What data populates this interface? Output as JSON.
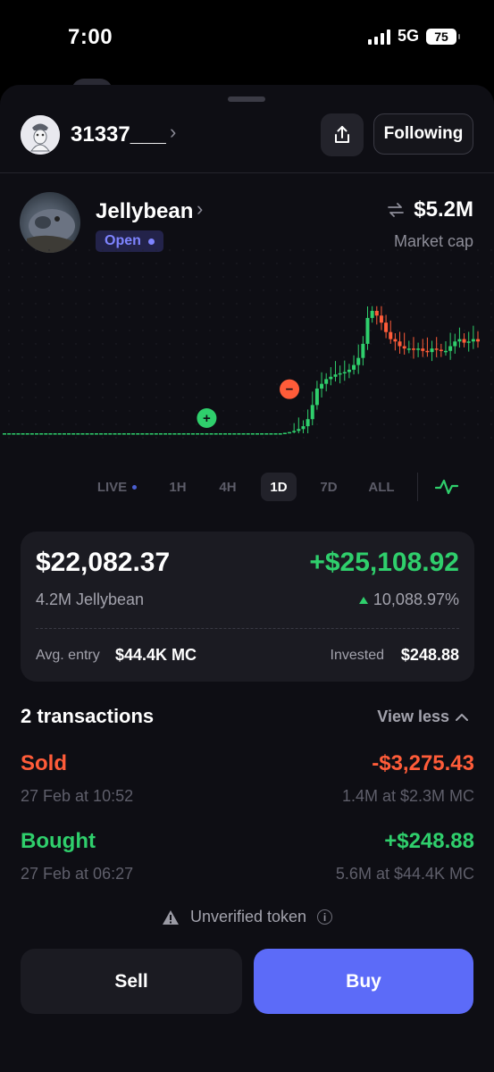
{
  "status_bar": {
    "time": "7:00",
    "network": "5G",
    "battery": "75"
  },
  "profile": {
    "username": "31337___",
    "follow_label": "Following"
  },
  "token": {
    "name": "Jellybean",
    "status": "Open",
    "market_cap": "$5.2M",
    "market_cap_label": "Market cap"
  },
  "chart_data": {
    "type": "candlestick",
    "title": "",
    "xlabel": "",
    "ylabel": "",
    "grid": true,
    "y_axis_visible": false,
    "candles_up_color": "#2fcf6c",
    "candles_down_color": "#ff5c39",
    "markers": [
      {
        "label": "+",
        "kind": "buy",
        "color": "#2fcf6c"
      },
      {
        "label": "−",
        "kind": "sell",
        "color": "#ff5c39"
      }
    ],
    "note_values": "relative price levels (chart has no printed axis values)",
    "closes": [
      1,
      1,
      1,
      1,
      1,
      1,
      1,
      1,
      1,
      1,
      1,
      1,
      1,
      1,
      1,
      1,
      1,
      1,
      1,
      1,
      1,
      1,
      1,
      1,
      1,
      1,
      1,
      1,
      1,
      1,
      1,
      1,
      1,
      1,
      1,
      1,
      1,
      1,
      1,
      1,
      1,
      1,
      1,
      1,
      1,
      1,
      1,
      1,
      1,
      1,
      1,
      1,
      1,
      1,
      1,
      1,
      1,
      1,
      1,
      1,
      1,
      1.02,
      1.05,
      1.1,
      1.18,
      1.3,
      1.6,
      2.2,
      2.9,
      3.1,
      3.3,
      3.4,
      3.5,
      3.55,
      3.6,
      3.7,
      3.9,
      4.2,
      4.8,
      5.9,
      6.2,
      6.0,
      5.7,
      5.3,
      5.0,
      4.9,
      4.7,
      4.6,
      4.6,
      4.55,
      4.6,
      4.5,
      4.45,
      4.6,
      4.55,
      4.5,
      4.5,
      4.7,
      4.9,
      5.0,
      4.85,
      4.9,
      5.0,
      4.9
    ]
  },
  "timeframes": [
    "LIVE",
    "1H",
    "4H",
    "1D",
    "7D",
    "ALL"
  ],
  "active_timeframe": "1D",
  "position": {
    "value": "$22,082.37",
    "pnl": "+$25,108.92",
    "amount": "4.2M Jellybean",
    "pnl_pct": "10,088.97%",
    "avg_entry_label": "Avg. entry",
    "avg_entry": "$44.4K MC",
    "invested_label": "Invested",
    "invested": "$248.88"
  },
  "transactions": {
    "header": "2 transactions",
    "toggle_label": "View less",
    "items": [
      {
        "type": "Sold",
        "amount": "-$3,275.43",
        "date": "27 Feb at 10:52",
        "detail": "1.4M at $2.3M MC"
      },
      {
        "type": "Bought",
        "amount": "+$248.88",
        "date": "27 Feb at 06:27",
        "detail": "5.6M at $44.4K MC"
      }
    ]
  },
  "warning": "Unverified token",
  "actions": {
    "sell": "Sell",
    "buy": "Buy"
  },
  "colors": {
    "accent": "#5c6bf8",
    "positive": "#2fcf6c",
    "negative": "#ff5c39",
    "background": "#0e0e14"
  }
}
